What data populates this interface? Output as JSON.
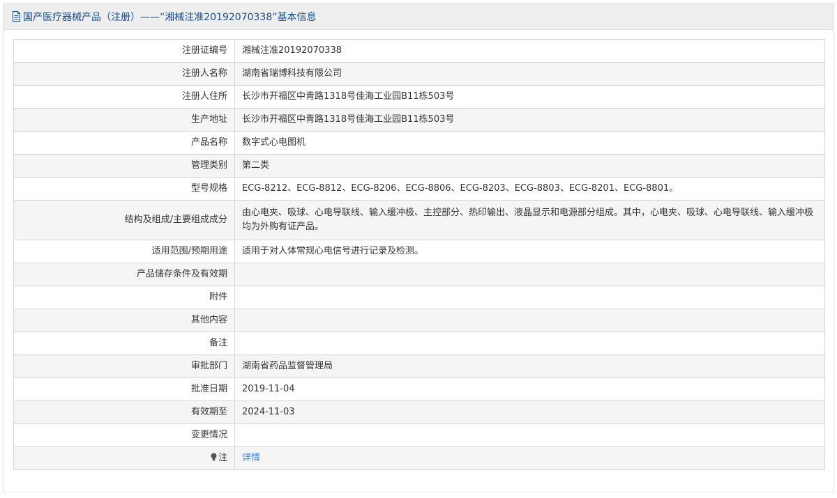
{
  "header": {
    "title": "国产医疗器械产品（注册）——“湘械注准20192070338”基本信息"
  },
  "rows": [
    {
      "label": "注册证编号",
      "value": "湘械注准20192070338"
    },
    {
      "label": "注册人名称",
      "value": "湖南省瑞博科技有限公司"
    },
    {
      "label": "注册人住所",
      "value": "长沙市开福区中青路1318号佳海工业园B11栋503号"
    },
    {
      "label": "生产地址",
      "value": "长沙市开福区中青路1318号佳海工业园B11栋503号"
    },
    {
      "label": "产品名称",
      "value": "数字式心电图机"
    },
    {
      "label": "管理类别",
      "value": "第二类"
    },
    {
      "label": "型号规格",
      "value": "ECG-8212、ECG-8812、ECG-8206、ECG-8806、ECG-8203、ECG-8803、ECG-8201、ECG-8801。"
    },
    {
      "label": "结构及组成/主要组成成分",
      "value": "由心电夹、吸球、心电导联线、输入缓冲极、主控部分、热印输出、液晶显示和电源部分组成。其中，心电夹、吸球、心电导联线、输入缓冲极均为外购有证产品。"
    },
    {
      "label": "适用范围/预期用途",
      "value": "适用于对人体常规心电信号进行记录及检测。"
    },
    {
      "label": "产品储存条件及有效期",
      "value": ""
    },
    {
      "label": "附件",
      "value": ""
    },
    {
      "label": "其他内容",
      "value": ""
    },
    {
      "label": "备注",
      "value": ""
    },
    {
      "label": "审批部门",
      "value": "湖南省药品监督管理局"
    },
    {
      "label": "批准日期",
      "value": "2019-11-04"
    },
    {
      "label": "有效期至",
      "value": "2024-11-03"
    },
    {
      "label": "变更情况",
      "value": ""
    }
  ],
  "note_row": {
    "icon": "bulb-icon",
    "label": "注",
    "link_text": "详情"
  },
  "colors": {
    "header_text": "#1a4f8a",
    "link": "#3b7dd8",
    "header_bg": "#eeeeee",
    "alt_row_bg": "#f5f5f5"
  }
}
